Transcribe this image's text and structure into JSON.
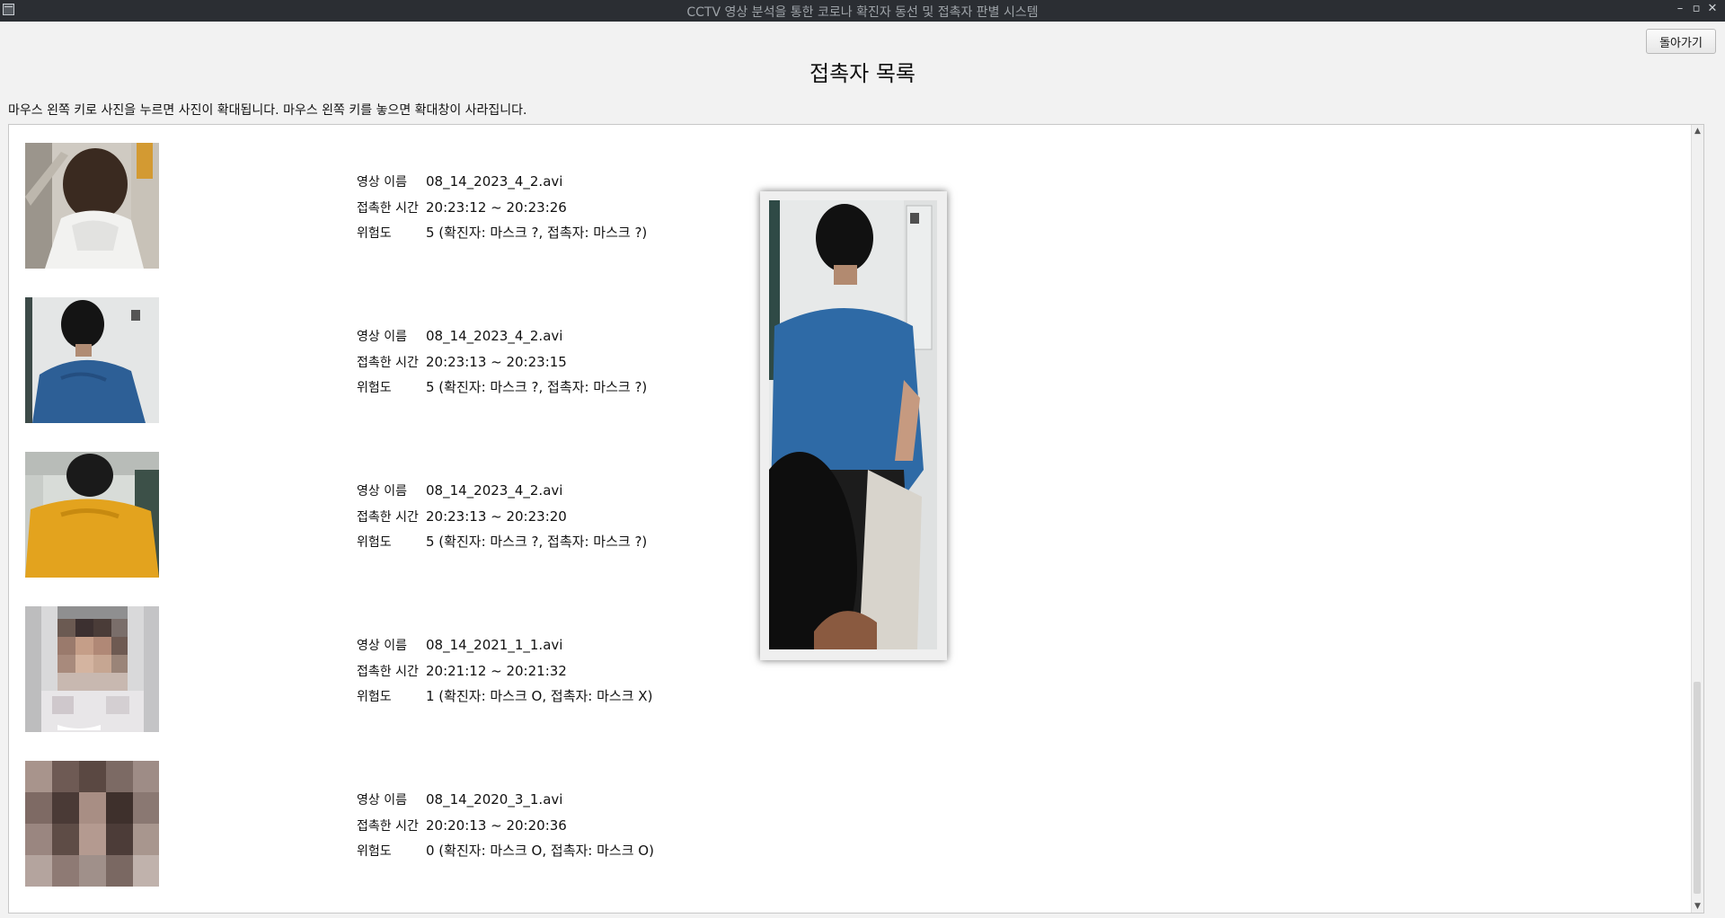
{
  "window": {
    "title": "CCTV 영상 분석을 통한 코로나 확진자 동선 및 접촉자 판별 시스템",
    "minimize_glyph": "–",
    "maximize_glyph": "▫",
    "close_glyph": "✕"
  },
  "header": {
    "back_button": "돌아가기",
    "title": "접촉자 목록",
    "instruction": "마우스 왼쪽 키로 사진을 누르면 사진이 확대됩니다. 마우스 왼쪽 키를 놓으면 확대창이 사라집니다."
  },
  "labels": {
    "video_name": "영상 이름",
    "contact_time": "접촉한 시간",
    "risk": "위험도"
  },
  "contacts": [
    {
      "video": "08_14_2023_4_2.avi",
      "time": "20:23:12 ~ 20:23:26",
      "risk": "5  (확진자: 마스크 ?, 접촉자: 마스크 ?)",
      "photo": "person-white-shirt-back"
    },
    {
      "video": "08_14_2023_4_2.avi",
      "time": "20:23:13 ~ 20:23:15",
      "risk": "5  (확진자: 마스크 ?, 접촉자: 마스크 ?)",
      "photo": "person-blue-shirt-back"
    },
    {
      "video": "08_14_2023_4_2.avi",
      "time": "20:23:13 ~ 20:23:20",
      "risk": "5  (확진자: 마스크 ?, 접촉자: 마스크 ?)",
      "photo": "person-yellow-shirt-back"
    },
    {
      "video": "08_14_2021_1_1.avi",
      "time": "20:21:12 ~ 20:21:32",
      "risk": "1  (확진자: 마스크 O, 접촉자: 마스크 X)",
      "photo": "pixelated-face"
    },
    {
      "video": "08_14_2020_3_1.avi",
      "time": "20:20:13 ~ 20:20:36",
      "risk": "0  (확진자: 마스크 O, 접촉자: 마스크 O)",
      "photo": "pixelated-face"
    }
  ],
  "zoom_popup": {
    "photo": "person-blue-shirt-back-enlarged"
  },
  "colors": {
    "titlebar_bg": "#2b2e33",
    "window_bg": "#f2f2f2",
    "list_bg": "#ffffff"
  }
}
